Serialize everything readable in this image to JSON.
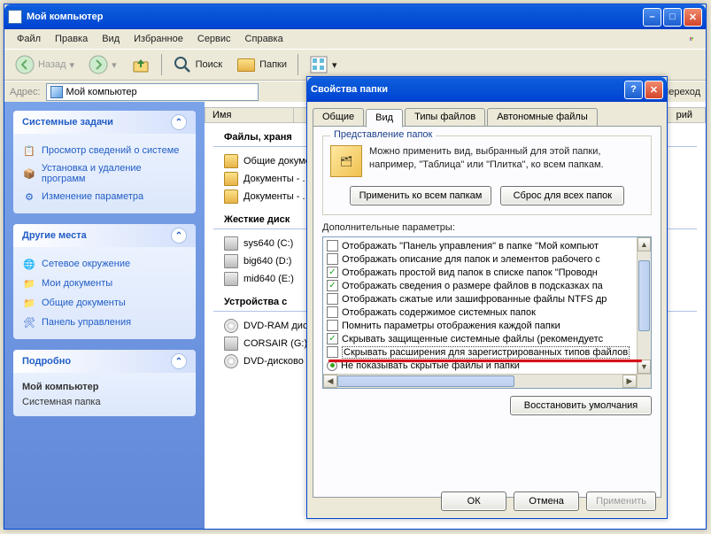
{
  "main_window": {
    "title": "Мой компьютер",
    "menu": [
      "Файл",
      "Правка",
      "Вид",
      "Избранное",
      "Сервис",
      "Справка"
    ],
    "toolbar": {
      "back": "Назад",
      "search": "Поиск",
      "folders": "Папки"
    },
    "addressbar": {
      "label": "Адрес:",
      "value": "Мой компьютер",
      "go": "Переход"
    },
    "sidebar": {
      "panels": [
        {
          "title": "Системные задачи",
          "items": [
            "Просмотр сведений о системе",
            "Установка и удаление программ",
            "Изменение параметра"
          ]
        },
        {
          "title": "Другие места",
          "items": [
            "Сетевое окружение",
            "Мои документы",
            "Общие документы",
            "Панель управления"
          ]
        },
        {
          "title": "Подробно",
          "detail_name": "Мой компьютер",
          "detail_type": "Системная папка"
        }
      ]
    },
    "content": {
      "col_name": "Имя",
      "col_trailing": "рий",
      "groups": [
        {
          "title": "Файлы, храня",
          "items": [
            "Общие докуме",
            "Документы - .",
            "Документы - ."
          ]
        },
        {
          "title": "Жесткие диск",
          "items": [
            "sys640 (C:)",
            "big640 (D:)",
            "mid640 (E:)"
          ]
        },
        {
          "title": "Устройства с",
          "items": [
            "DVD-RAM дис.",
            "CORSAIR (G:)",
            "DVD-дисково"
          ]
        }
      ]
    }
  },
  "dialog": {
    "title": "Свойства папки",
    "tabs": [
      "Общие",
      "Вид",
      "Типы файлов",
      "Автономные файлы"
    ],
    "active_tab": 1,
    "folder_views": {
      "legend": "Представление папок",
      "text": "Можно применить вид, выбранный для этой папки, например, \"Таблица\" или \"Плитка\", ко всем папкам.",
      "apply_btn": "Применить ко всем папкам",
      "reset_btn": "Сброс для всех папок"
    },
    "advanced": {
      "label": "Дополнительные параметры:",
      "items": [
        {
          "type": "cb",
          "checked": false,
          "text": "Отображать \"Панель управления\" в папке \"Мой компьют"
        },
        {
          "type": "cb",
          "checked": false,
          "text": "Отображать описание для папок и элементов рабочего с"
        },
        {
          "type": "cb",
          "checked": true,
          "text": "Отображать простой вид папок в списке папок \"Проводн"
        },
        {
          "type": "cb",
          "checked": true,
          "text": "Отображать сведения о размере файлов в подсказках па"
        },
        {
          "type": "cb",
          "checked": false,
          "text": "Отображать сжатые или зашифрованные файлы NTFS др"
        },
        {
          "type": "cb",
          "checked": false,
          "text": "Отображать содержимое системных папок"
        },
        {
          "type": "cb",
          "checked": false,
          "text": "Помнить параметры отображения каждой папки"
        },
        {
          "type": "cb",
          "checked": true,
          "text": "Скрывать защищенные системные файлы (рекомендуетс"
        },
        {
          "type": "cb",
          "checked": false,
          "text": "Скрывать расширения для зарегистрированных типов файлов",
          "highlight": true
        },
        {
          "type": "rd",
          "checked": true,
          "text": "Не показывать скрытые файлы и папки"
        }
      ],
      "restore_btn": "Восстановить умолчания"
    },
    "buttons": {
      "ok": "ОК",
      "cancel": "Отмена",
      "apply": "Применить"
    }
  }
}
